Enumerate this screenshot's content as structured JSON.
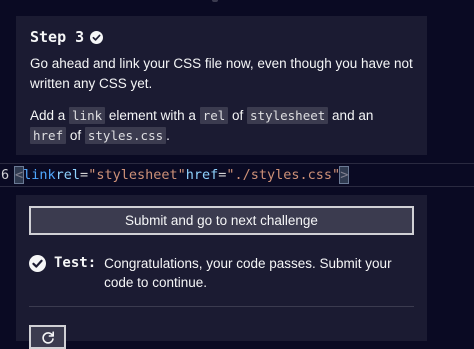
{
  "step": {
    "title": "Step 3",
    "instruction_1": "Go ahead and link your CSS file now, even though you have not written any CSS yet.",
    "instruction_2_parts": [
      "Add a ",
      "link",
      " element with a ",
      "rel",
      " of ",
      "stylesheet",
      " and an ",
      "href",
      " of ",
      "styles.css",
      "."
    ]
  },
  "editor": {
    "line_number": "6",
    "code": {
      "open": "<",
      "tag": "link",
      "attr_rel": "rel",
      "eq": "=",
      "val_rel": "\"stylesheet\"",
      "attr_href": "href",
      "val_href": "\"./styles.css\"",
      "close": ">"
    }
  },
  "submit": {
    "label": "Submit and go to next challenge"
  },
  "test": {
    "label": "Test:",
    "message": "Congratulations, your code passes. Submit your code to continue."
  },
  "icons": {
    "check": "check-circle-icon",
    "reset": "reset-icon"
  },
  "colors": {
    "background": "#0a0a23",
    "panel": "#1b1b32",
    "button": "#3b3b4f",
    "tag": "#4fa7ff",
    "attr": "#8fd2fe",
    "string": "#ce9178"
  }
}
